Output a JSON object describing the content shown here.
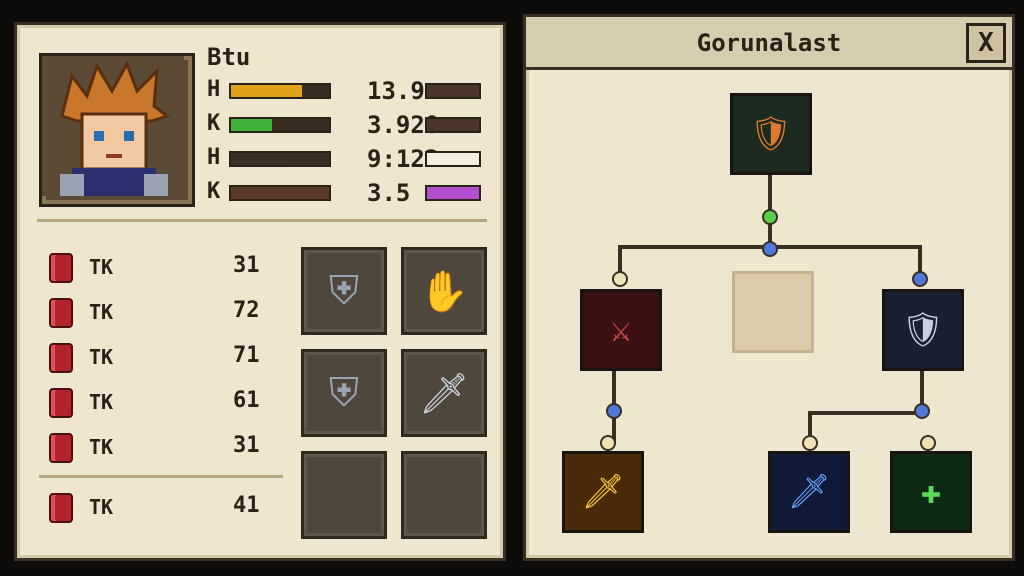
{
  "character": {
    "name": "Btu",
    "stats": [
      {
        "key": "H",
        "value": "13.9",
        "fill": 0.72,
        "color": "#e0a21a",
        "fill2": 0.0,
        "color2": "#5a3d2a"
      },
      {
        "key": "K",
        "value": "3.920",
        "fill": 0.42,
        "color": "#3fb23a",
        "fill2": 0.0,
        "color2": "#5a3d2a"
      },
      {
        "key": "H",
        "value": "9:122",
        "fill": 0.55,
        "color": "#3a2f24",
        "fill2": 1.0,
        "color2": "#f6efdc"
      },
      {
        "key": "K",
        "value": "3.5",
        "fill": 1.0,
        "color": "#5a3a2c",
        "fill2": 1.0,
        "color2": "#b14fd0"
      }
    ]
  },
  "inventory": [
    {
      "label": "TK",
      "count": "31"
    },
    {
      "label": "TK",
      "count": "72"
    },
    {
      "label": "TK",
      "count": "71"
    },
    {
      "label": "TK",
      "count": "61"
    },
    {
      "label": "TK",
      "count": "31"
    },
    {
      "label": "TK",
      "count": "41"
    }
  ],
  "equipment": [
    {
      "icon": "chest-armor-icon",
      "glyph": "⛨"
    },
    {
      "icon": "gauntlet-icon",
      "glyph": "✋"
    },
    {
      "icon": "heavy-armor-icon",
      "glyph": "⛨"
    },
    {
      "icon": "sword-icon",
      "glyph": "🗡"
    },
    {
      "icon": "empty-slot",
      "glyph": ""
    },
    {
      "icon": "empty-slot",
      "glyph": ""
    }
  ],
  "skill_tree": {
    "title": "Gorunalast",
    "close_label": "X",
    "nodes": [
      {
        "name": "hero-portrait-node",
        "glyph": "🛡",
        "empty": false
      },
      {
        "name": "empty-node",
        "glyph": "",
        "empty": true
      },
      {
        "name": "red-slash-node",
        "glyph": "⚔",
        "empty": false
      },
      {
        "name": "knight-shield-node",
        "glyph": "🛡",
        "empty": false
      },
      {
        "name": "golden-sword-node",
        "glyph": "🗡",
        "empty": false
      },
      {
        "name": "blue-blade-node",
        "glyph": "🗡",
        "empty": false
      },
      {
        "name": "green-shield-node",
        "glyph": "✚",
        "empty": false
      }
    ]
  },
  "colors": {
    "panel_bg": "#efe6cf",
    "border": "#3a2f24",
    "accent_red": "#b3232b"
  }
}
